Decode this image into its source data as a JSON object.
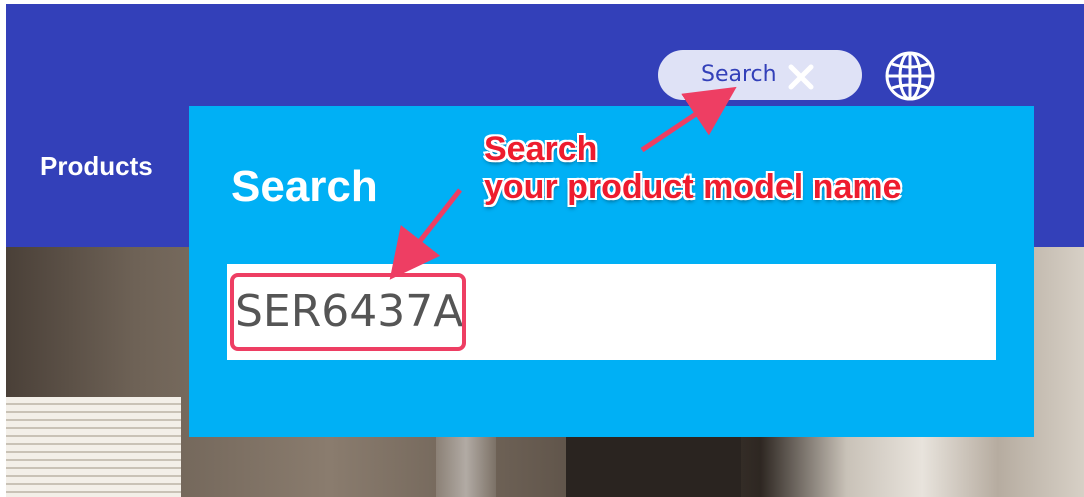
{
  "header": {
    "nav_products": "Products",
    "search_pill_label": "Search",
    "globe_icon": "globe-icon",
    "close_icon": "close-icon"
  },
  "search_panel": {
    "title": "Search",
    "input_value": "SER6437A"
  },
  "annotation": {
    "line1": "Search",
    "line2": "your product model name",
    "color": "#ee1c2e"
  },
  "colors": {
    "header_bg": "#3340b9",
    "panel_bg": "#00b0f5",
    "pill_bg": "#dfe2f6",
    "highlight": "#ee3e63"
  }
}
